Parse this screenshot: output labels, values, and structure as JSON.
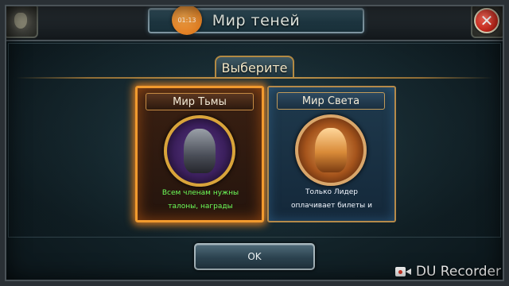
{
  "header": {
    "title": "Мир теней",
    "timer": "01:13",
    "close_icon": "close-x-icon"
  },
  "selection": {
    "label": "Выберите"
  },
  "cards": [
    {
      "title": "Мир Тьмы",
      "desc_line1": "Всем членам нужны",
      "desc_line2": "талоны, награды",
      "emblem_icon": "dark-knight-emblem-icon",
      "selected": true,
      "accent": "#f19a2e"
    },
    {
      "title": "Мир Света",
      "desc_line1": "Только Лидер",
      "desc_line2": "оплачивает билеты и",
      "emblem_icon": "light-knight-emblem-icon",
      "selected": false,
      "accent": "#b58a4a"
    }
  ],
  "ok_button": {
    "label": "OK"
  },
  "watermark": {
    "text": "DU Recorder",
    "icon": "video-camera-icon"
  }
}
